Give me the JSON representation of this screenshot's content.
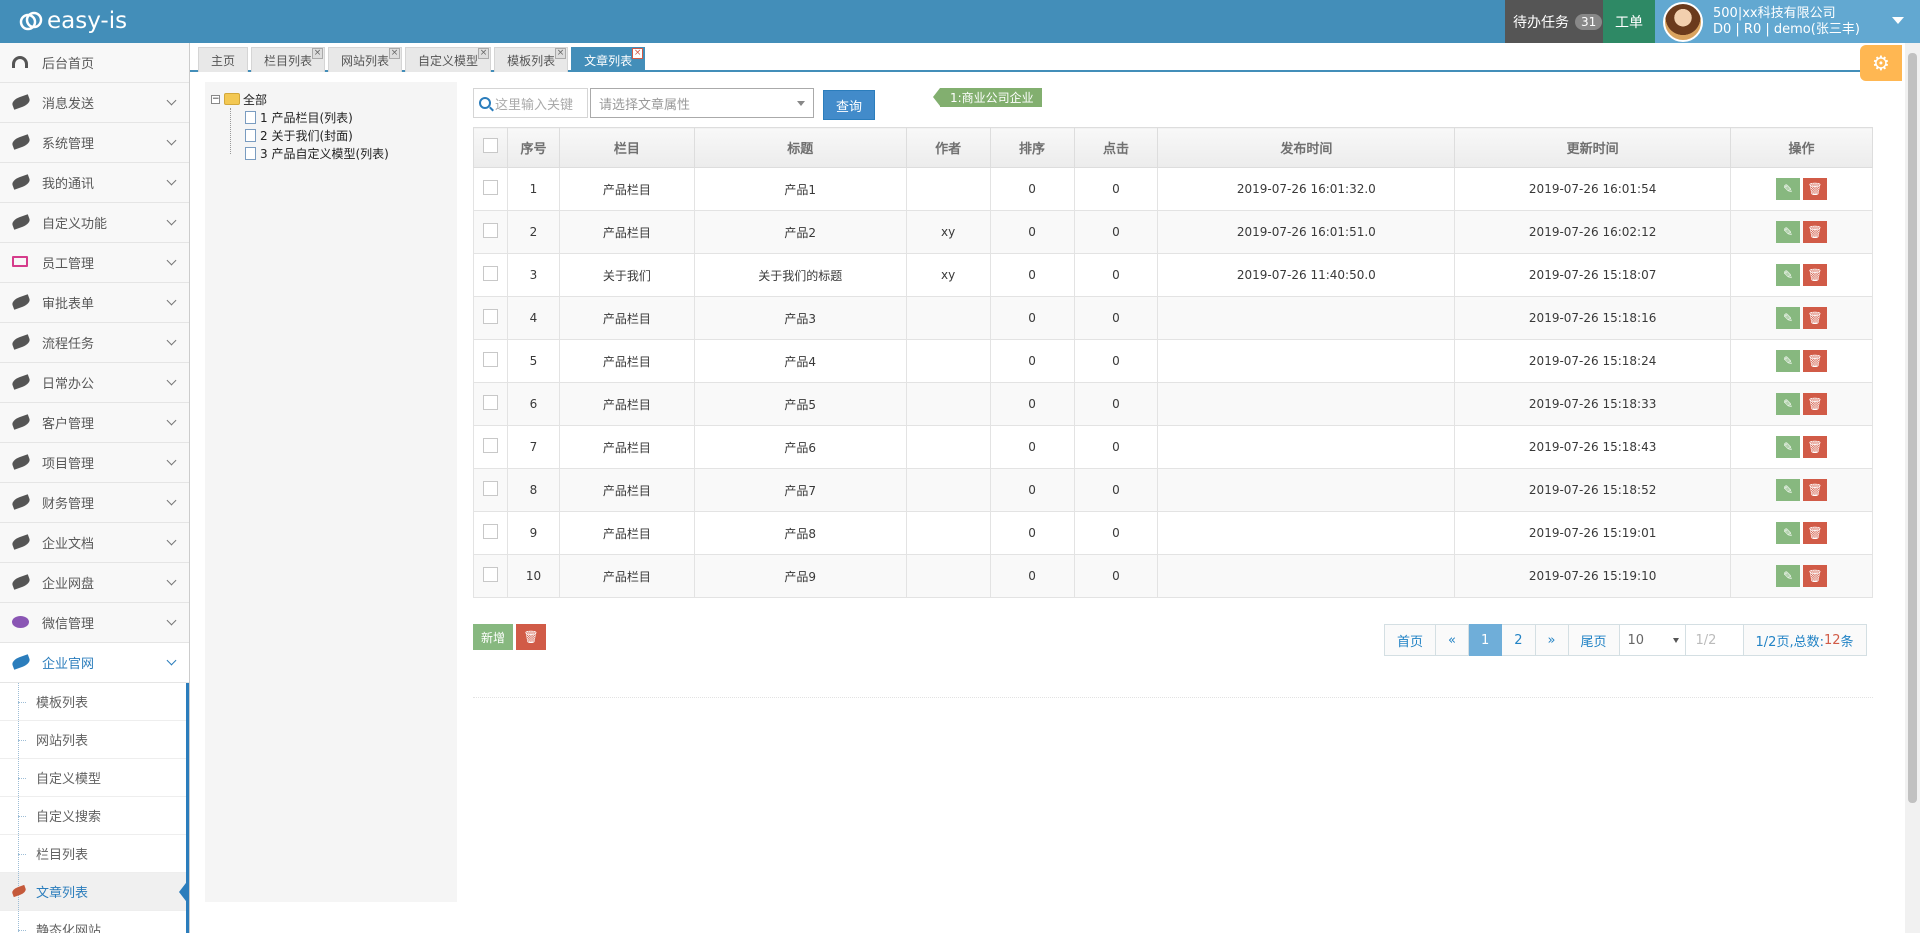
{
  "brand": {
    "name": "easy-is"
  },
  "header": {
    "tasks_label": "待办任务",
    "tasks_count": "31",
    "order_label": "工单",
    "company": "500|xx科技有限公司",
    "user_line": "D0 | R0 | demo(张三丰)"
  },
  "sidebar": {
    "items": [
      {
        "label": "后台首页",
        "icon": "dashboard-icon"
      },
      {
        "label": "消息发送",
        "icon": "leaf-icon"
      },
      {
        "label": "系统管理",
        "icon": "leaf-icon"
      },
      {
        "label": "我的通讯",
        "icon": "leaf-icon"
      },
      {
        "label": "自定义功能",
        "icon": "leaf-icon"
      },
      {
        "label": "员工管理",
        "icon": "desktop-icon"
      },
      {
        "label": "审批表单",
        "icon": "leaf-icon"
      },
      {
        "label": "流程任务",
        "icon": "leaf-icon"
      },
      {
        "label": "日常办公",
        "icon": "leaf-icon"
      },
      {
        "label": "客户管理",
        "icon": "leaf-icon"
      },
      {
        "label": "项目管理",
        "icon": "leaf-icon"
      },
      {
        "label": "财务管理",
        "icon": "leaf-icon"
      },
      {
        "label": "企业文档",
        "icon": "leaf-icon"
      },
      {
        "label": "企业网盘",
        "icon": "leaf-icon"
      },
      {
        "label": "微信管理",
        "icon": "chat-icon"
      },
      {
        "label": "企业官网",
        "icon": "leaf-icon"
      }
    ],
    "subitems": [
      "模板列表",
      "网站列表",
      "自定义模型",
      "自定义搜索",
      "栏目列表",
      "文章列表",
      "静态化网站"
    ]
  },
  "tabs": [
    "主页",
    "栏目列表",
    "网站列表",
    "自定义模型",
    "模板列表",
    "文章列表"
  ],
  "tree": {
    "root": "全部",
    "children": [
      "1 产品栏目(列表)",
      "2 关于我们(封面)",
      "3 产品自定义模型(列表)"
    ]
  },
  "toolbar": {
    "search_placeholder": "这里输入关键",
    "select_placeholder": "请选择文章属性",
    "query_label": "查询",
    "tag_label": "1:商业公司企业"
  },
  "table": {
    "headers": [
      "序号",
      "栏目",
      "标题",
      "作者",
      "排序",
      "点击",
      "发布时间",
      "更新时间",
      "操作"
    ],
    "rows": [
      [
        "1",
        "产品栏目",
        "产品1",
        "",
        "0",
        "0",
        "2019-07-26 16:01:32.0",
        "2019-07-26 16:01:54"
      ],
      [
        "2",
        "产品栏目",
        "产品2",
        "xy",
        "0",
        "0",
        "2019-07-26 16:01:51.0",
        "2019-07-26 16:02:12"
      ],
      [
        "3",
        "关于我们",
        "关于我们的标题",
        "xy",
        "0",
        "0",
        "2019-07-26 11:40:50.0",
        "2019-07-26 15:18:07"
      ],
      [
        "4",
        "产品栏目",
        "产品3",
        "",
        "0",
        "0",
        "",
        "2019-07-26 15:18:16"
      ],
      [
        "5",
        "产品栏目",
        "产品4",
        "",
        "0",
        "0",
        "",
        "2019-07-26 15:18:24"
      ],
      [
        "6",
        "产品栏目",
        "产品5",
        "",
        "0",
        "0",
        "",
        "2019-07-26 15:18:33"
      ],
      [
        "7",
        "产品栏目",
        "产品6",
        "",
        "0",
        "0",
        "",
        "2019-07-26 15:18:43"
      ],
      [
        "8",
        "产品栏目",
        "产品7",
        "",
        "0",
        "0",
        "",
        "2019-07-26 15:18:52"
      ],
      [
        "9",
        "产品栏目",
        "产品8",
        "",
        "0",
        "0",
        "",
        "2019-07-26 15:19:01"
      ],
      [
        "10",
        "产品栏目",
        "产品9",
        "",
        "0",
        "0",
        "",
        "2019-07-26 15:19:10"
      ]
    ]
  },
  "actions": {
    "add_label": "新增"
  },
  "pager": {
    "first": "首页",
    "prev": "«",
    "pages": [
      "1",
      "2"
    ],
    "next": "»",
    "last": "尾页",
    "page_size": "10",
    "jump_placeholder": "1/2",
    "info_prefix": "1/2页,总数:",
    "total": "12",
    "info_suffix": "条"
  }
}
